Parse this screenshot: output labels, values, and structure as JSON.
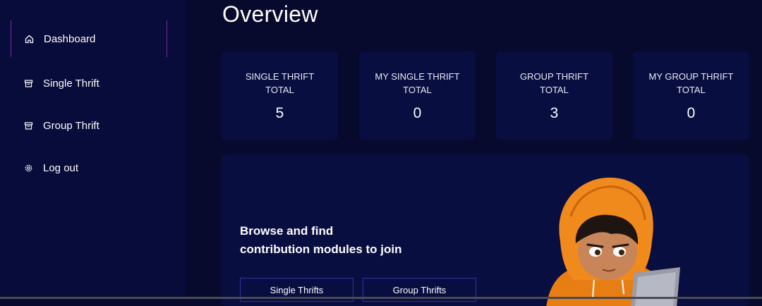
{
  "sidebar": {
    "items": [
      {
        "label": "Dashboard",
        "icon": "home-icon",
        "active": true
      },
      {
        "label": "Single Thrift",
        "icon": "archive-icon",
        "active": false
      },
      {
        "label": "Group Thrift",
        "icon": "archive-icon",
        "active": false
      },
      {
        "label": "Log out",
        "icon": "gear-icon",
        "active": false
      }
    ]
  },
  "main": {
    "title": "Overview",
    "stats": [
      {
        "label": "SINGLE THRIFT TOTAL",
        "value": "5"
      },
      {
        "label": "MY SINGLE THRIFT TOTAL",
        "value": "0"
      },
      {
        "label": "GROUP THRIFT TOTAL",
        "value": "3"
      },
      {
        "label": "MY GROUP THRIFT TOTAL",
        "value": "0"
      }
    ],
    "promo": {
      "line1": "Browse and find",
      "line2": "contribution modules to join",
      "buttons": [
        {
          "label": "Single Thrifts"
        },
        {
          "label": "Group Thrifts"
        }
      ]
    }
  },
  "colors": {
    "background": "#070a2c",
    "sidebar": "#070c3b",
    "card": "#080f40",
    "active_border": "#7a2a9a",
    "button_border": "#3c2f9c",
    "hoodie": "#f08a1c"
  }
}
